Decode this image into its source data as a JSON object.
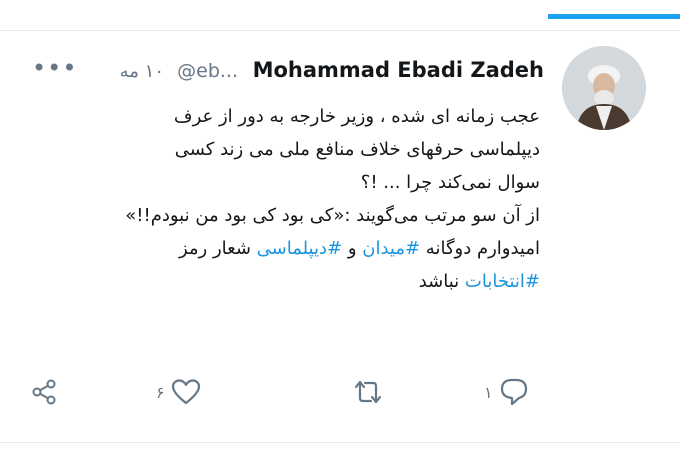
{
  "author": {
    "name": "Mohammad Ebadi Zadeh",
    "handle": "@eb...",
    "time": "۱۰ مه"
  },
  "tweet": {
    "line1": "عجب زمانه ای شده ، وزیر خارجه به دور از عرف",
    "line2": "دیپلماسی حرفهای خلاف منافع ملی می زند کسی",
    "line3": "سوال نمی‌کند چرا ... !؟",
    "line4": "از آن سو مرتب می‌گویند :«کی بود کی بود من نبودم!!»",
    "line5_pre": "امیدوارم دوگانه ",
    "hashtag_meydan": "#میدان",
    "line5_mid": " و ",
    "hashtag_diplomacy": "#دیپلماسی",
    "line5_post": " شعار رمز",
    "hashtag_elections": "#انتخابات",
    "line6_post": " نباشد"
  },
  "actions": {
    "reply_count": "۱",
    "retweet_count": "",
    "like_count": "۶",
    "share_count": ""
  },
  "colors": {
    "accent": "#1da1f2",
    "hashtag": "#1b95e0",
    "muted": "#657786"
  }
}
